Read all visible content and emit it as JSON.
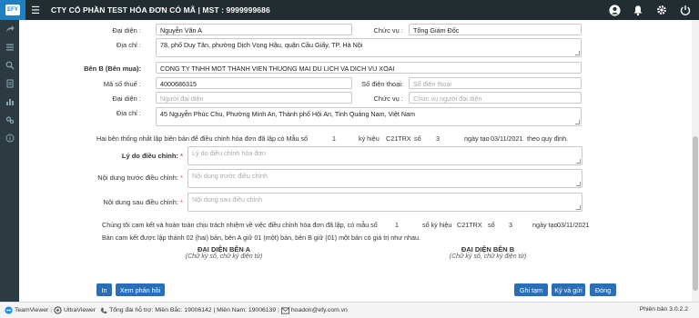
{
  "header": {
    "logo_text": "EFY",
    "company": "CTY CỔ PHẦN TEST HÓA ĐƠN CÓ MÃ | MST : 9999999686"
  },
  "party_a": {
    "representative_label": "Đại diện :",
    "representative_value": "Nguyễn Văn A",
    "position_label": "Chức vụ :",
    "position_value": "Tổng Giám Đốc",
    "address_label": "Địa chỉ :",
    "address_value": "78, phố Duy Tân, phường Dịch Vọng Hậu, quận Cầu Giấy, TP. Hà Nội"
  },
  "party_b": {
    "buyer_label": "Bên B (Bên mua):",
    "buyer_value": "CONG TY TNHH MOT THANH VIEN THUONG MAI DU LICH VA DICH VU XOAI",
    "tax_label": "Mã số thuế :",
    "tax_value": "4000686315",
    "phone_label": "Số điện thoại:",
    "phone_placeholder": "Số điện thoại",
    "representative_label": "Đại diện :",
    "representative_placeholder": "Người đại diện",
    "position_label": "Chức vụ :",
    "position_placeholder": "Chức vụ người đại diện",
    "address_label": "Địa chỉ :",
    "address_value": "45 Nguyễn Phúc Chu, Phường Minh An, Thành phố Hội An, Tỉnh Quảng Nam, Việt Nam"
  },
  "agreement": {
    "p1": "Hai bên thống nhất lập biên bản để điều chỉnh hóa đơn đã lập có Mẫu số",
    "p1_form_no": "1",
    "p1_symbol_label": "ký hiệu",
    "p1_symbol": "C21TRX",
    "p1_no_label": "số",
    "p1_no": "3",
    "p1_date_label": "ngày tạo",
    "p1_date": "03/11/2021",
    "p1_end": "theo quy định."
  },
  "adjust": {
    "reason_label": "Lý do điều chỉnh:",
    "reason_placeholder": "Lý do điều chỉnh hóa đơn",
    "before_label": "Nội dung trước điều chỉnh:",
    "before_placeholder": "Nội dung trước điều chỉnh",
    "after_label": "Nội dung sau điều chỉnh:",
    "after_placeholder": "Nội dung sau điều chỉnh",
    "required_mark": "*"
  },
  "commit": {
    "c1": "Chúng tôi cam kết và hoàn toàn chịu trách nhiệm về việc điều chỉnh hóa đơn đã lập, có mẫu số",
    "c1_form_no": "1",
    "c1_symbol_label": "số ký hiệu",
    "c1_symbol": "C21TRX",
    "c1_no_label": "số",
    "c1_no": "3",
    "c1_date_label": "ngày tạo",
    "c1_date": "03/11/2021",
    "c2": "Bản cam kết được lập thành 02 (hai) bản, bên A giữ 01 (một) bản, bên B giữ (01) một bản có giá trị như nhau."
  },
  "signatures": {
    "a_title": "ĐẠI DIỆN BÊN A",
    "a_sub": "(Chữ ký số, chữ ký điện tử)",
    "b_title": "ĐẠI DIỆN BÊN B",
    "b_sub": "(Chữ ký số, chữ ký điện tử)"
  },
  "buttons": {
    "print": "In",
    "preview": "Xem phản hồi",
    "save_draft": "Ghi tạm",
    "sign_send": "Ký và gửi",
    "close": "Đóng"
  },
  "footer": {
    "teamviewer": "TeamViewer",
    "ultraviewer": "UltraViewer",
    "hotline": "Tổng đài hỗ trợ: Miền Bắc: 19006142 | Miền Nam: 19006139",
    "email": "hoadon@efy.com.vn",
    "version": "Phiên bản 3.0.2.2"
  },
  "colors": {
    "topbar": "#222d32",
    "sidebar": "#2c3b41",
    "button": "#2a6eb5",
    "required": "#d9534f"
  }
}
